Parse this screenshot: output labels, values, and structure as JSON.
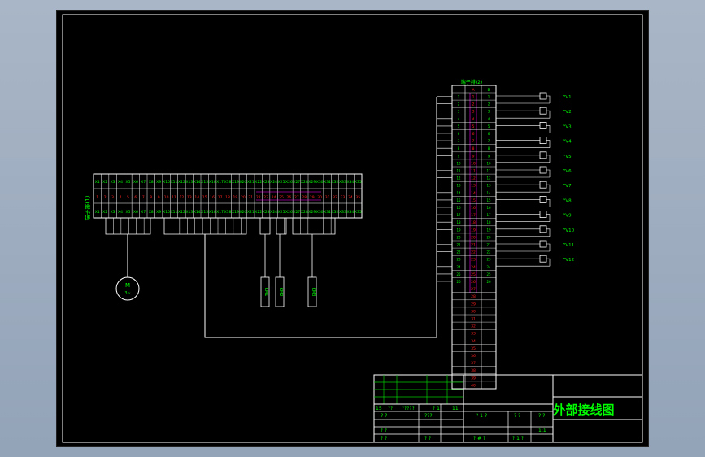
{
  "drawing": {
    "title": "外部接线图",
    "colors": {
      "background": "#000000",
      "line": "#ffffff",
      "text_green": "#00ff00",
      "text_red": "#ff2020",
      "text_cyan": "#00ffff",
      "tb_green": "#00c800",
      "magenta": "#ff00ff"
    },
    "left_terminal": {
      "side_label": "端子排(1)",
      "cell_labels_top": [
        "X1",
        "X2",
        "X3",
        "X4",
        "X5",
        "X6",
        "X7",
        "X8",
        "X9",
        "X10",
        "X11",
        "X12",
        "X13",
        "X14",
        "X15",
        "X16",
        "X17",
        "X18",
        "X19",
        "X20",
        "X21",
        "X22",
        "X23",
        "X24",
        "X25",
        "X26",
        "X27",
        "X28",
        "X29",
        "X30",
        "X31",
        "X32",
        "X33",
        "X34",
        "X35"
      ],
      "cell_labels_mid": [
        "1",
        "2",
        "3",
        "4",
        "5",
        "6",
        "7",
        "8",
        "9",
        "10",
        "11",
        "12",
        "13",
        "14",
        "15",
        "16",
        "17",
        "18",
        "19",
        "20",
        "21",
        "22",
        "23",
        "24",
        "25",
        "26",
        "27",
        "28",
        "29",
        "30",
        "31",
        "32",
        "33",
        "34",
        "35"
      ]
    },
    "motor_label": "M",
    "motor_sub": "3~",
    "components": [
      {
        "label": "KM1"
      },
      {
        "label": "KM2"
      },
      {
        "label": "KM3"
      }
    ],
    "right_terminal": {
      "header": "端子排(2)",
      "col_labels": [
        "A",
        "B"
      ],
      "rows": [
        "1",
        "2",
        "3",
        "4",
        "5",
        "6",
        "7",
        "8",
        "9",
        "10",
        "11",
        "12",
        "13",
        "14",
        "15",
        "16",
        "17",
        "18",
        "19",
        "20",
        "21",
        "22",
        "23",
        "24",
        "25",
        "26",
        "27",
        "28",
        "29",
        "30",
        "31",
        "32",
        "33",
        "34",
        "35",
        "36",
        "37",
        "38",
        "39",
        "40"
      ]
    },
    "outputs": [
      "YV1",
      "YV2",
      "YV3",
      "YV4",
      "YV5",
      "YV6",
      "YV7",
      "YV8",
      "YV9",
      "YV10",
      "YV11",
      "YV12"
    ],
    "title_block": {
      "row_a": [
        "15",
        "??",
        "?????",
        "? 1",
        "11"
      ],
      "row_b": [
        "? ?",
        "???",
        "? 1 ?",
        "? ?",
        "? ?"
      ],
      "row_c": [
        "? ?",
        "1:1"
      ],
      "row_d": [
        "? ?",
        "? ?",
        "? # ?",
        "? 1 ?"
      ]
    }
  }
}
